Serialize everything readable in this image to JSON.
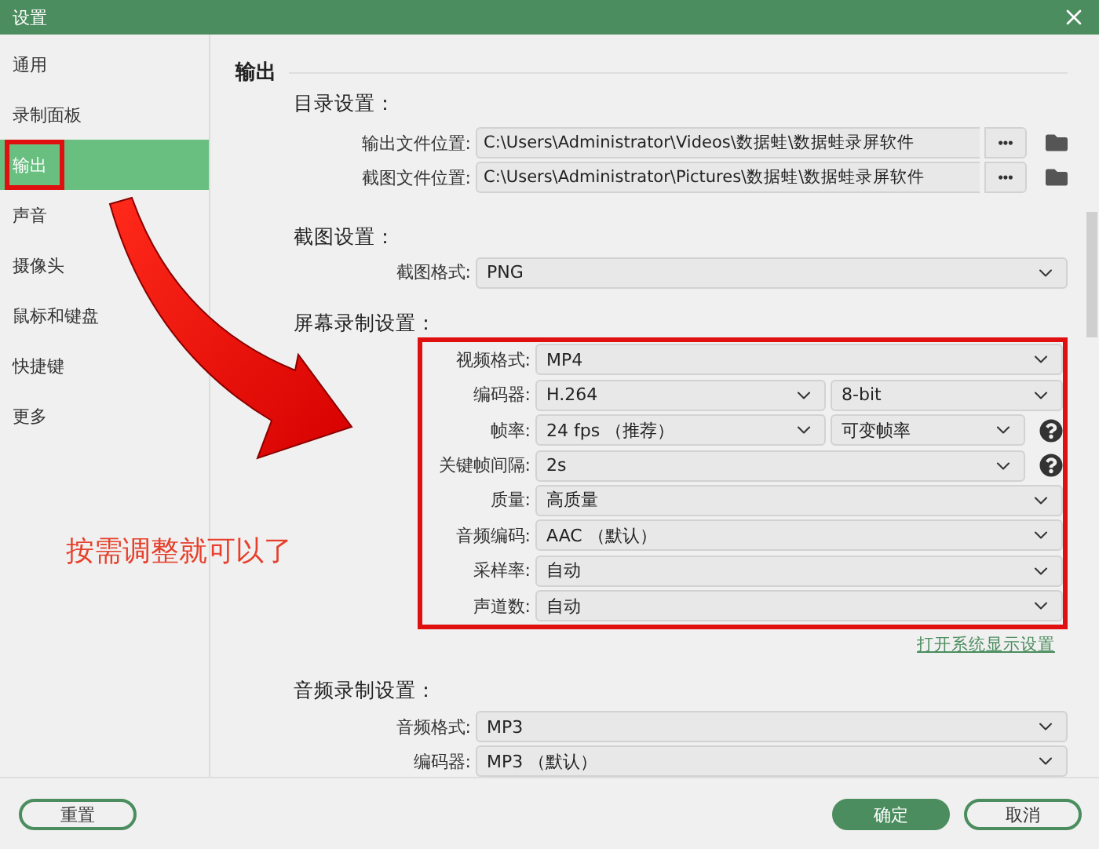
{
  "window": {
    "title": "设置"
  },
  "sidebar": {
    "items": [
      {
        "label": "通用",
        "selected": false,
        "annotated": false
      },
      {
        "label": "录制面板",
        "selected": false,
        "annotated": false
      },
      {
        "label": "输出",
        "selected": true,
        "annotated": true
      },
      {
        "label": "声音",
        "selected": false,
        "annotated": false
      },
      {
        "label": "摄像头",
        "selected": false,
        "annotated": false
      },
      {
        "label": "鼠标和键盘",
        "selected": false,
        "annotated": false
      },
      {
        "label": "快捷键",
        "selected": false,
        "annotated": false
      },
      {
        "label": "更多",
        "selected": false,
        "annotated": false
      }
    ]
  },
  "panel": {
    "title": "输出",
    "sections": [
      {
        "heading": "目录设置：",
        "highlighted": false,
        "rows": [
          {
            "kind": "path",
            "label": "输出文件位置:",
            "value": "C:\\Users\\Administrator\\Videos\\数据蛙\\数据蛙录屏软件",
            "browse": "•••"
          },
          {
            "kind": "path",
            "label": "截图文件位置:",
            "value": "C:\\Users\\Administrator\\Pictures\\数据蛙\\数据蛙录屏软件",
            "browse": "•••"
          }
        ]
      },
      {
        "heading": "截图设置：",
        "highlighted": false,
        "rows": [
          {
            "kind": "select",
            "label": "截图格式:",
            "fields": [
              "PNG"
            ],
            "help": false
          }
        ]
      },
      {
        "heading": "屏幕录制设置：",
        "highlighted": true,
        "link": "打开系统显示设置",
        "rows": [
          {
            "kind": "select",
            "label": "视频格式:",
            "fields": [
              "MP4"
            ],
            "help": false
          },
          {
            "kind": "select",
            "label": "编码器:",
            "fields": [
              "H.264",
              "8-bit"
            ],
            "help": false
          },
          {
            "kind": "select",
            "label": "帧率:",
            "fields": [
              "24 fps （推荐）",
              "可变帧率"
            ],
            "help": true
          },
          {
            "kind": "select",
            "label": "关键帧间隔:",
            "fields": [
              "2s"
            ],
            "help": true
          },
          {
            "kind": "select",
            "label": "质量:",
            "fields": [
              "高质量"
            ],
            "help": false
          },
          {
            "kind": "select",
            "label": "音频编码:",
            "fields": [
              "AAC （默认）"
            ],
            "help": false
          },
          {
            "kind": "select",
            "label": "采样率:",
            "fields": [
              "自动"
            ],
            "help": false
          },
          {
            "kind": "select",
            "label": "声道数:",
            "fields": [
              "自动"
            ],
            "help": false
          }
        ]
      },
      {
        "heading": "音频录制设置：",
        "highlighted": false,
        "rows": [
          {
            "kind": "select",
            "label": "音频格式:",
            "fields": [
              "MP3"
            ],
            "help": false
          },
          {
            "kind": "select",
            "label": "编码器:",
            "fields": [
              "MP3 （默认）"
            ],
            "help": false
          }
        ]
      }
    ]
  },
  "footer": {
    "buttons": [
      {
        "label": "重置",
        "kind": "secondary"
      },
      {
        "label": "确定",
        "kind": "primary"
      },
      {
        "label": "取消",
        "kind": "secondary"
      }
    ]
  },
  "annotation": {
    "note": "按需调整就可以了"
  }
}
